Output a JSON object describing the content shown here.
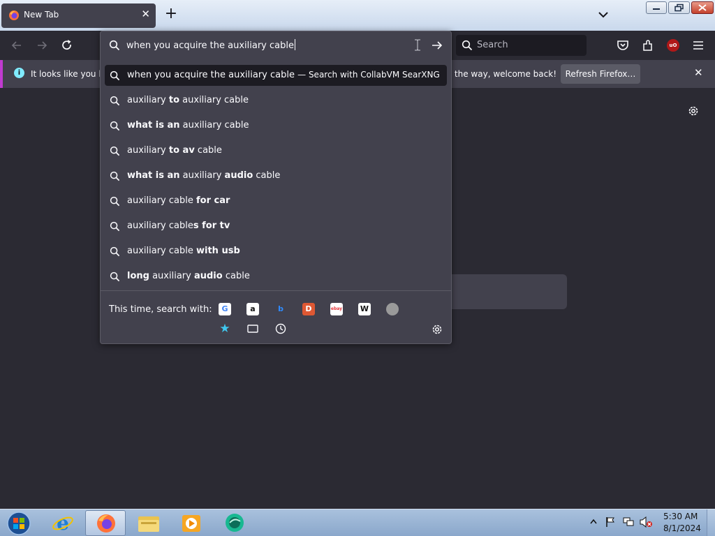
{
  "window": {
    "tab_title": "New Tab",
    "tab_close_label": "✕",
    "new_tab_label": "+"
  },
  "toolbar": {
    "search_placeholder": "Search"
  },
  "notification": {
    "text_left": "It looks like you ha",
    "text_right": "y the way, welcome back!",
    "refresh_label": "Refresh Firefox…",
    "close_label": "✕",
    "info_glyph": "i"
  },
  "urlbar": {
    "query": "when you acquire the auxiliary cable",
    "first_result": {
      "text": "when you acquire the auxiliary cable",
      "action": "— Search with CollabVM SearXNG"
    },
    "suggestions": [
      [
        {
          "t": "auxiliary ",
          "b": false
        },
        {
          "t": "to",
          "b": true
        },
        {
          "t": " auxiliary cable",
          "b": false
        }
      ],
      [
        {
          "t": "what is an",
          "b": true
        },
        {
          "t": " auxiliary cable",
          "b": false
        }
      ],
      [
        {
          "t": "auxiliary ",
          "b": false
        },
        {
          "t": "to av",
          "b": true
        },
        {
          "t": " cable",
          "b": false
        }
      ],
      [
        {
          "t": "what is an",
          "b": true
        },
        {
          "t": " auxiliary ",
          "b": false
        },
        {
          "t": "audio",
          "b": true
        },
        {
          "t": " cable",
          "b": false
        }
      ],
      [
        {
          "t": "auxiliary cable ",
          "b": false
        },
        {
          "t": "for car",
          "b": true
        }
      ],
      [
        {
          "t": "auxiliary cable",
          "b": false
        },
        {
          "t": "s for tv",
          "b": true
        }
      ],
      [
        {
          "t": "auxiliary cable ",
          "b": false
        },
        {
          "t": "with usb",
          "b": true
        }
      ],
      [
        {
          "t": "long",
          "b": true
        },
        {
          "t": " auxiliary ",
          "b": false
        },
        {
          "t": "audio",
          "b": true
        },
        {
          "t": " cable",
          "b": false
        }
      ]
    ],
    "oneoff_label": "This time, search with:",
    "engines": [
      {
        "name": "google",
        "glyph": "G",
        "bg": "#ffffff",
        "fg": "#4285f4"
      },
      {
        "name": "amazon",
        "glyph": "a",
        "bg": "#ffffff",
        "fg": "#111111"
      },
      {
        "name": "bing",
        "glyph": "b",
        "bg": "transparent",
        "fg": "#2f8bff"
      },
      {
        "name": "duckduckgo",
        "glyph": "D",
        "bg": "#de5833",
        "fg": "#ffffff"
      },
      {
        "name": "ebay",
        "glyph": "ebay",
        "bg": "#ffffff",
        "fg": "#e53238"
      },
      {
        "name": "wikipedia",
        "glyph": "W",
        "bg": "#ffffff",
        "fg": "#111111"
      },
      {
        "name": "searxng",
        "glyph": "",
        "bg": "#9a9a9a",
        "fg": "#ffffff"
      }
    ],
    "modes": [
      {
        "name": "bookmarks-mode-icon",
        "glyph": "★"
      },
      {
        "name": "tabs-mode-icon",
        "glyph": ""
      },
      {
        "name": "history-mode-icon",
        "glyph": ""
      }
    ]
  },
  "taskbar": {
    "apps": [
      "internet-explorer",
      "firefox",
      "file-explorer",
      "media-player",
      "collabvm-app"
    ],
    "time": "5:30 AM",
    "date": "8/1/2024"
  },
  "colors": {
    "accent": "#c03bd0",
    "panel": "#42414d",
    "background": "#2b2a33"
  }
}
